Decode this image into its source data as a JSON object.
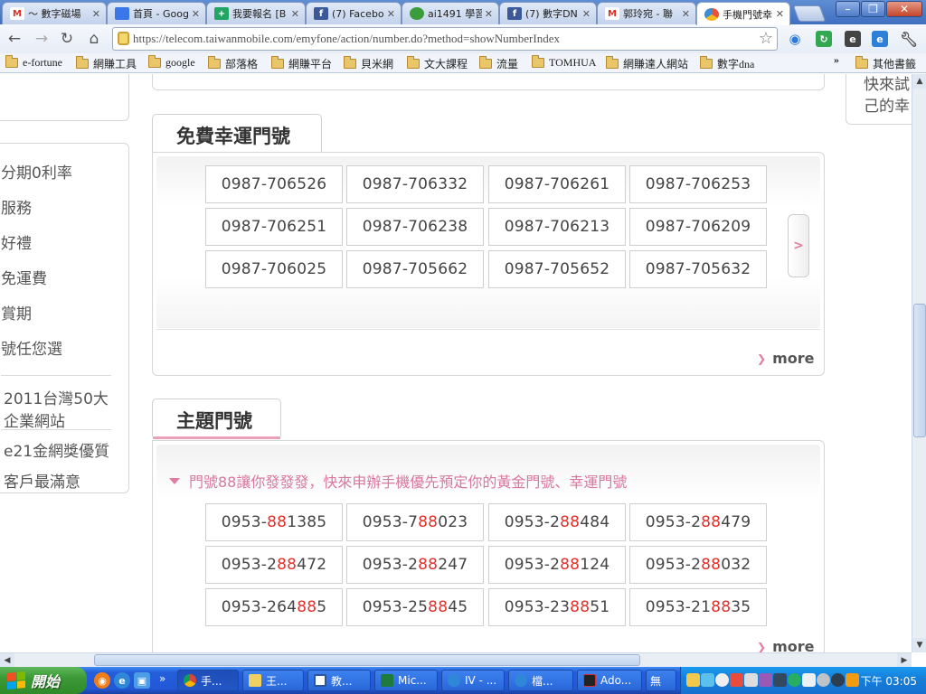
{
  "browser": {
    "tabs": [
      {
        "label": "～ 數字磁場",
        "icon": "gmail-icon",
        "icon_text": "M",
        "icon_color": "#d93025"
      },
      {
        "label": "首頁 - Goog",
        "icon": "google-docs-icon",
        "icon_text": "",
        "icon_color": "#3b78e7"
      },
      {
        "label": "我要報名 [B",
        "icon": "google-sheets-icon",
        "icon_text": "+",
        "icon_color": "#21a464"
      },
      {
        "label": "(7) Facebook",
        "icon": "facebook-icon",
        "icon_text": "f",
        "icon_color": "#3b5998"
      },
      {
        "label": "ai1491 學習",
        "icon": "globe-icon",
        "icon_text": "",
        "icon_color": "#3a9d3a"
      },
      {
        "label": "(7) 數字DN",
        "icon": "facebook-icon",
        "icon_text": "f",
        "icon_color": "#3b5998"
      },
      {
        "label": "郭玲宛 - 聯",
        "icon": "gmail-icon",
        "icon_text": "M",
        "icon_color": "#d93025"
      },
      {
        "label": "手機門號幸",
        "icon": "taiwanmobile-icon",
        "icon_text": "",
        "icon_color": "#e8513c"
      }
    ],
    "url": "https://telecom.taiwanmobile.com/emyfone/action/number.do?method=showNumberIndex",
    "bookmarks": [
      "e-fortune",
      "網賺工具",
      "google",
      "部落格",
      "網賺平台",
      "貝米網",
      "文大課程",
      "流量",
      "TOMHUA",
      "網賺達人網站",
      "數字dna"
    ],
    "bookmarks_more": "»",
    "other_bookmarks": "其他書籤"
  },
  "sidebar": {
    "items": [
      "分期0利率",
      "服務",
      "好禮",
      "免運費",
      "賞期",
      "號任您選"
    ],
    "links": [
      "2011台灣50大",
      "企業網站",
      "e21金網獎優質",
      "客戶最滿意"
    ]
  },
  "right_panel": {
    "lines": [
      "快來試",
      "己的幸"
    ]
  },
  "free_lucky": {
    "title": "免費幸運門號",
    "numbers": [
      "0987-706526",
      "0987-706332",
      "0987-706261",
      "0987-706253",
      "0987-706251",
      "0987-706238",
      "0987-706213",
      "0987-706209",
      "0987-706025",
      "0987-705662",
      "0987-705652",
      "0987-705632"
    ],
    "next_arrow": ">",
    "more": "more"
  },
  "theme_numbers": {
    "title": "主題門號",
    "promo": "門號88讓你發發發，快來申辦手機優先預定你的黃金門號、幸運門號",
    "numbers": [
      {
        "pre": "0953-",
        "hl": "88",
        "post": "1385"
      },
      {
        "pre": "0953-7",
        "hl": "88",
        "post": "023"
      },
      {
        "pre": "0953-2",
        "hl": "88",
        "post": "484"
      },
      {
        "pre": "0953-2",
        "hl": "88",
        "post": "479"
      },
      {
        "pre": "0953-2",
        "hl": "88",
        "post": "472"
      },
      {
        "pre": "0953-2",
        "hl": "88",
        "post": "247"
      },
      {
        "pre": "0953-2",
        "hl": "88",
        "post": "124"
      },
      {
        "pre": "0953-2",
        "hl": "88",
        "post": "032"
      },
      {
        "pre": "0953-264",
        "hl": "88",
        "post": "5"
      },
      {
        "pre": "0953-25",
        "hl": "88",
        "post": "45"
      },
      {
        "pre": "0953-23",
        "hl": "88",
        "post": "51"
      },
      {
        "pre": "0953-21",
        "hl": "88",
        "post": "35"
      }
    ],
    "more": "more",
    "highlight_color": "#e1302b"
  },
  "taskbar": {
    "start": "開始",
    "items": [
      "手...",
      "王...",
      "教...",
      "Mic...",
      "IV - ...",
      "檔...",
      "Ado...",
      "無"
    ],
    "clock": "下午 03:05"
  }
}
